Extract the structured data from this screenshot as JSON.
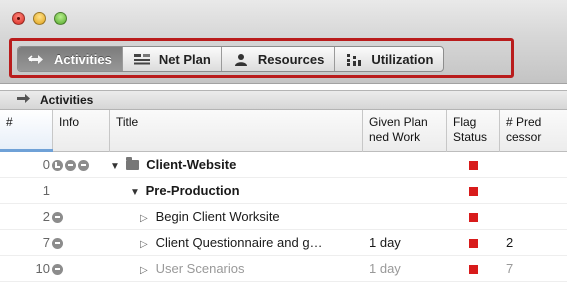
{
  "toolbar": {
    "tabs": [
      {
        "label": "Activities",
        "icon": "arrows-icon",
        "active": true
      },
      {
        "label": "Net Plan",
        "icon": "net-plan-icon",
        "active": false
      },
      {
        "label": "Resources",
        "icon": "person-icon",
        "active": false
      },
      {
        "label": "Utilization",
        "icon": "utilization-icon",
        "active": false
      }
    ],
    "highlight_color": "#b91c1c"
  },
  "pane": {
    "title": "Activities"
  },
  "columns": {
    "hash": "#",
    "info": "Info",
    "title": "Title",
    "given_planned_work": "Given Plan\nned Work",
    "flag_status": "Flag\nStatus",
    "predecessors": "# Pred\ncessor"
  },
  "rows": [
    {
      "num": "0",
      "info_icons": [
        "clock-icon",
        "note-icon",
        "note-icon"
      ],
      "triangle": "open",
      "folder": true,
      "title": "Client-Website",
      "work": "",
      "flag": true,
      "pred": "",
      "bold": true
    },
    {
      "num": "1",
      "info_icons": [],
      "triangle": "open",
      "folder": false,
      "title": "Pre-Production",
      "work": "",
      "flag": true,
      "pred": "",
      "bold": true
    },
    {
      "num": "2",
      "info_icons": [
        "note-icon"
      ],
      "triangle": "closed",
      "folder": false,
      "title": "Begin Client Worksite",
      "work": "",
      "flag": true,
      "pred": "",
      "bold": false
    },
    {
      "num": "7",
      "info_icons": [
        "note-icon"
      ],
      "triangle": "closed",
      "folder": false,
      "title": "Client Questionnaire and g…",
      "work": "1 day",
      "flag": true,
      "pred": "2",
      "bold": false
    },
    {
      "num": "10",
      "info_icons": [
        "note-icon"
      ],
      "triangle": "closed",
      "folder": false,
      "title": "User Scenarios",
      "work": "1 day",
      "flag": true,
      "pred": "7",
      "bold": false
    }
  ],
  "flag_color": "#d81b1b"
}
